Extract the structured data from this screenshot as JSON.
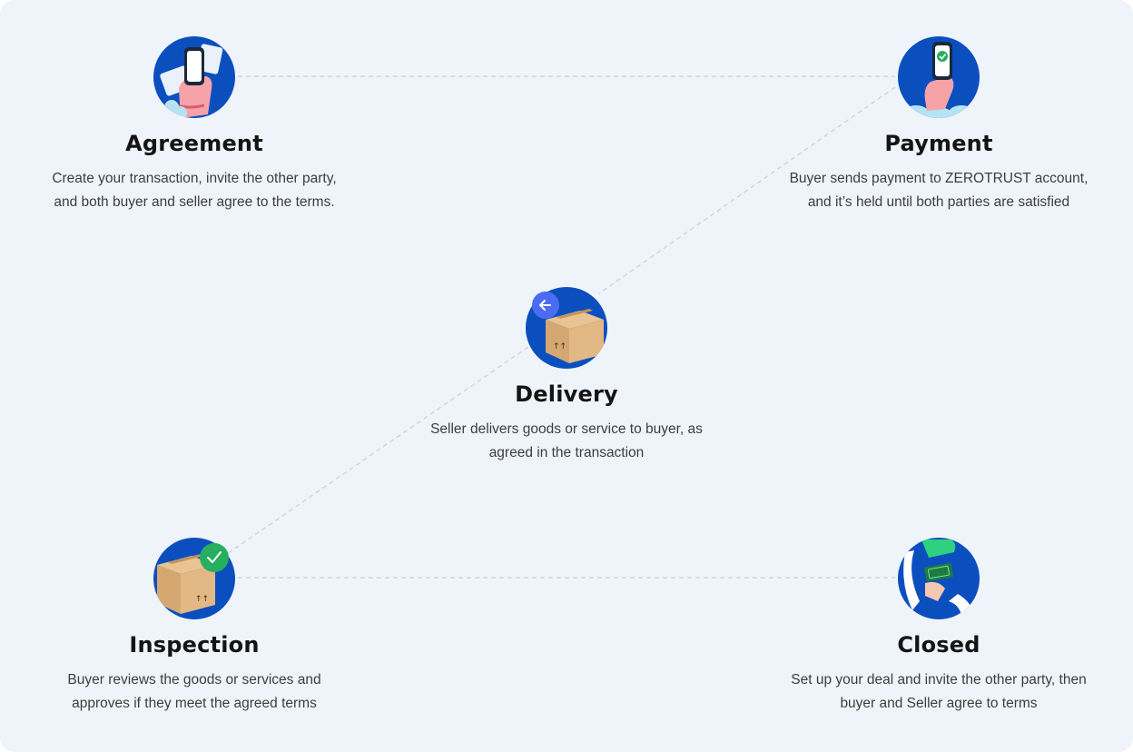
{
  "steps": [
    {
      "id": "agreement",
      "title": "Agreement",
      "desc_line1": "Create your transaction, invite the other party,",
      "desc_line2": "and both buyer and seller agree to the terms.",
      "icon": "hand-holding-phone-icon"
    },
    {
      "id": "payment",
      "title": "Payment",
      "desc_line1": "Buyer sends payment to ZEROTRUST account,",
      "desc_line2": "and it’s held until both parties are satisfied",
      "icon": "phone-payment-check-icon"
    },
    {
      "id": "delivery",
      "title": "Delivery",
      "desc_line1": "Seller delivers goods or service to buyer, as",
      "desc_line2": "agreed in the transaction",
      "icon": "package-delivery-icon"
    },
    {
      "id": "inspection",
      "title": "Inspection",
      "desc_line1": "Buyer reviews the goods or services and",
      "desc_line2": "approves if they meet the agreed terms",
      "icon": "package-approved-icon"
    },
    {
      "id": "closed",
      "title": "Closed",
      "desc_line1": "Set up your deal and invite the other party, then",
      "desc_line2": "buyer and Seller agree to terms",
      "icon": "money-handover-icon"
    }
  ],
  "colors": {
    "background": "#eff4fa",
    "circle": "#0b4fbf",
    "title": "#141414",
    "text": "#3d3d3d",
    "connector": "#cfd8d8",
    "check_badge": "#27ae60",
    "arrow_badge": "#4b6cf0"
  }
}
